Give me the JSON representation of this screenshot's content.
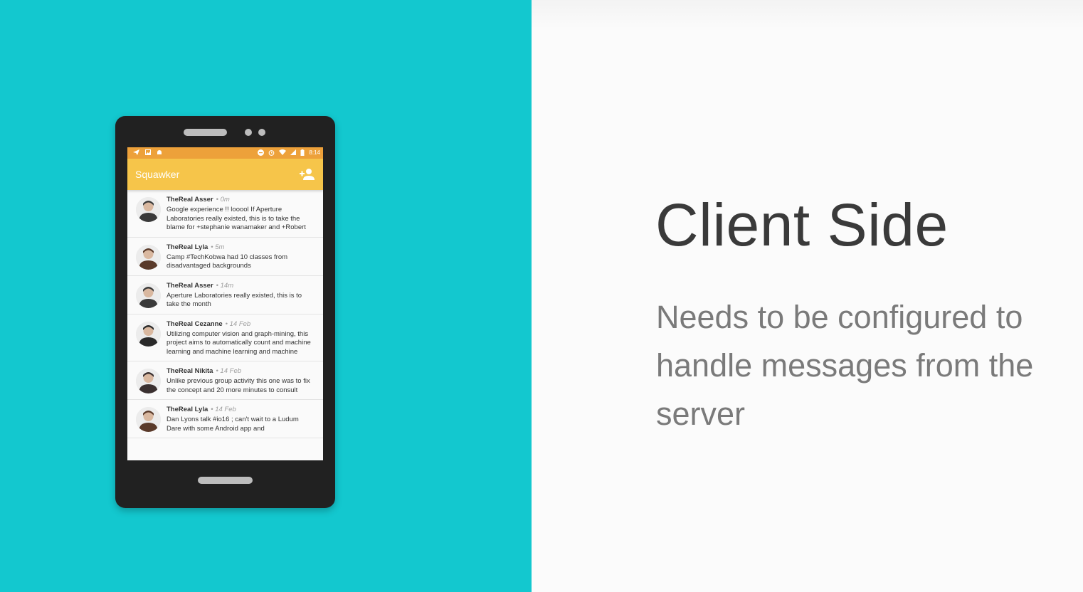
{
  "slide": {
    "title": "Client Side",
    "subtitle": "Needs to be configured to handle messages from the server"
  },
  "colors": {
    "left_panel": "#13c8cf",
    "status_bar": "#eda13a",
    "app_bar": "#f6c54a",
    "phone_body": "#212121"
  },
  "phone": {
    "status_bar": {
      "left_icons": [
        "send-icon",
        "image-icon",
        "android-icon"
      ],
      "right_icons": [
        "do-not-disturb-icon",
        "alarm-icon",
        "wifi-icon",
        "signal-icon",
        "battery-icon"
      ],
      "time": "8:14"
    },
    "app_bar": {
      "title": "Squawker",
      "action_icon": "person-add-icon"
    },
    "posts": [
      {
        "author": "TheReal Asser",
        "time": "• 0m",
        "message": "Google experience !! looool If Aperture Laboratories really existed, this is to take the blame for +stephanie wanamaker and +Robert"
      },
      {
        "author": "TheReal Lyla",
        "time": "• 5m",
        "message": "Camp #TechKobwa had 10 classes from disadvantaged backgrounds"
      },
      {
        "author": "TheReal Asser",
        "time": "• 14m",
        "message": "Aperture Laboratories really existed, this is to take the month"
      },
      {
        "author": "TheReal Cezanne",
        "time": "• 14 Feb",
        "message": "Utilizing computer vision and graph-mining, this project aims to automatically count and machine learning and machine learning and machine"
      },
      {
        "author": "TheReal Nikita",
        "time": "• 14 Feb",
        "message": "Unlike previous group activity this one was to fix the concept and 20 more minutes to consult"
      },
      {
        "author": "TheReal Lyla",
        "time": "• 14 Feb",
        "message": "Dan Lyons talk #io16 ; can't wait to a Ludum Dare with some Android app and"
      }
    ]
  }
}
